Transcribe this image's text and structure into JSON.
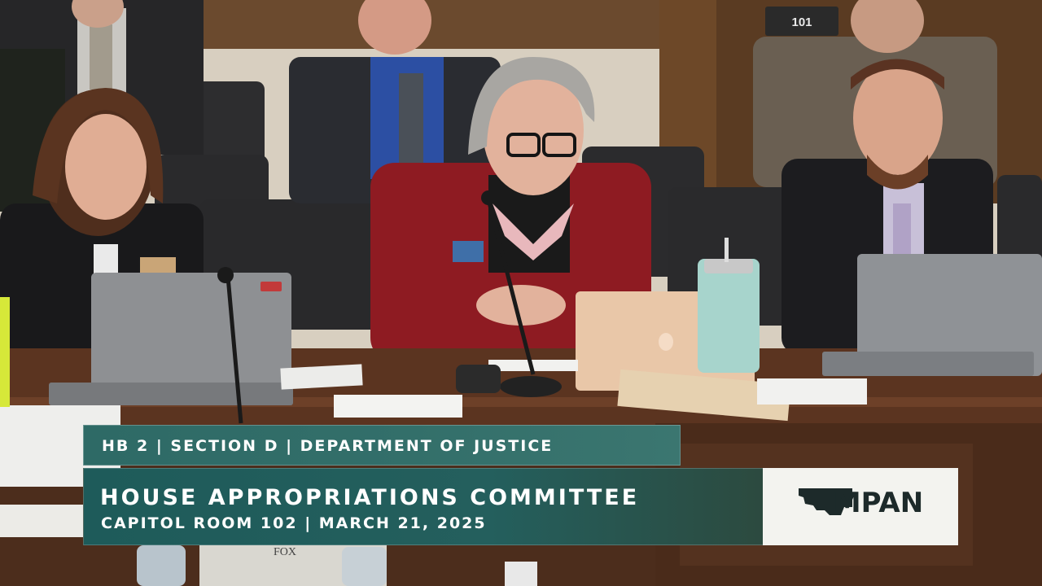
{
  "lower_third": {
    "top_bar": "HB 2 | SECTION D | DEPARTMENT OF JUSTICE",
    "title": "HOUSE APPROPRIATIONS COMMITTEE",
    "subtitle": "CAPITOL ROOM 102 | MARCH 21, 2025"
  },
  "logo": {
    "text": "MPAN",
    "icon": "montana-state-icon"
  },
  "scene": {
    "door_number": "101",
    "nameplate": "FOX"
  },
  "colors": {
    "bar_teal": "#2e6a66",
    "main_teal": "#1e5b5a",
    "logo_bg": "#f3f3ef",
    "logo_ink": "#1d2a2a"
  }
}
